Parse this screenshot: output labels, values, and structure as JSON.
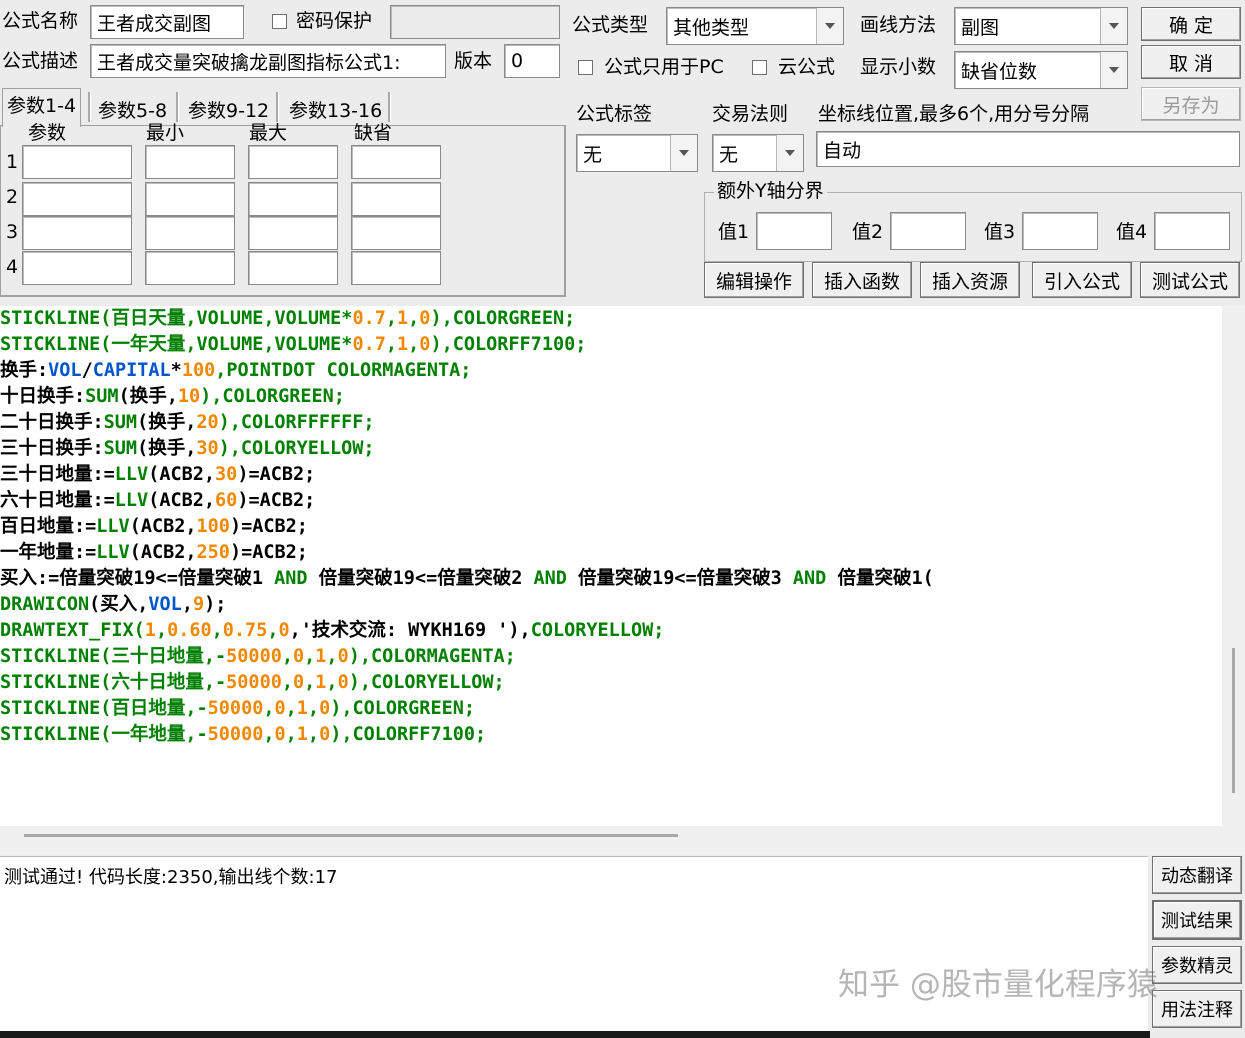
{
  "header": {
    "name_label": "公式名称",
    "name_value": "王者成交副图",
    "password_label": "密码保护",
    "desc_label": "公式描述",
    "desc_value": "王者成交量突破擒龙副图指标公式1:",
    "version_label": "版本",
    "version_value": "0",
    "type_label": "公式类型",
    "type_value": "其他类型",
    "draw_label": "画线方法",
    "draw_value": "副图",
    "pc_only_label": "公式只用于PC",
    "cloud_label": "云公式",
    "decimals_label": "显示小数",
    "decimals_value": "缺省位数"
  },
  "buttons": {
    "ok": "确  定",
    "cancel": "取  消",
    "save_as": "另存为",
    "edit": "编辑操作",
    "insert_func": "插入函数",
    "insert_res": "插入资源",
    "import_formula": "引入公式",
    "test_formula": "测试公式",
    "dyn_translate": "动态翻译",
    "test_result": "测试结果",
    "param_wizard": "参数精灵",
    "usage_notes": "用法注释"
  },
  "tabs": [
    "参数1-4",
    "参数5-8",
    "参数9-12",
    "参数13-16"
  ],
  "params": {
    "col_param": "参数",
    "col_min": "最小",
    "col_max": "最大",
    "col_default": "缺省",
    "rows": [
      "1",
      "2",
      "3",
      "4"
    ]
  },
  "options": {
    "tag_label": "公式标签",
    "tag_value": "无",
    "rule_label": "交易法则",
    "rule_value": "无",
    "axis_label": "坐标线位置,最多6个,用分号分隔",
    "axis_value": "自动",
    "extra_y_label": "额外Y轴分界",
    "v1": "值1",
    "v2": "值2",
    "v3": "值3",
    "v4": "值4"
  },
  "code_lines": [
    [
      [
        "STICKLINE(百日天量,VOLUME,VOLUME*",
        "g"
      ],
      [
        "0.7",
        "o"
      ],
      [
        ",",
        "g"
      ],
      [
        "1",
        "o"
      ],
      [
        ",",
        "g"
      ],
      [
        "0",
        "o"
      ],
      [
        "),COLORGREEN;",
        "g"
      ]
    ],
    [
      [
        "STICKLINE(一年天量,VOLUME,VOLUME*",
        "g"
      ],
      [
        "0.7",
        "o"
      ],
      [
        ",",
        "g"
      ],
      [
        "1",
        "o"
      ],
      [
        ",",
        "g"
      ],
      [
        "0",
        "o"
      ],
      [
        "),COLORFF7100;",
        "g"
      ]
    ],
    [
      [
        "换手:",
        "k"
      ],
      [
        "VOL",
        "b"
      ],
      [
        "/",
        "k"
      ],
      [
        "CAPITAL",
        "b"
      ],
      [
        "*",
        "k"
      ],
      [
        "100",
        "o"
      ],
      [
        ",POINTDOT COLORMAGENTA;",
        "g"
      ]
    ],
    [
      [
        "十日换手:",
        "k"
      ],
      [
        "SUM",
        "g"
      ],
      [
        "(换手,",
        "k"
      ],
      [
        "10",
        "o"
      ],
      [
        "),COLORGREEN;",
        "g"
      ]
    ],
    [
      [
        "二十日换手:",
        "k"
      ],
      [
        "SUM",
        "g"
      ],
      [
        "(换手,",
        "k"
      ],
      [
        "20",
        "o"
      ],
      [
        "),COLORFFFFFF;",
        "g"
      ]
    ],
    [
      [
        "三十日换手:",
        "k"
      ],
      [
        "SUM",
        "g"
      ],
      [
        "(换手,",
        "k"
      ],
      [
        "30",
        "o"
      ],
      [
        "),COLORYELLOW;",
        "g"
      ]
    ],
    [
      [
        "三十日地量:=",
        "k"
      ],
      [
        "LLV",
        "g"
      ],
      [
        "(ACB2,",
        "k"
      ],
      [
        "30",
        "o"
      ],
      [
        ")=ACB2;",
        "k"
      ]
    ],
    [
      [
        "六十日地量:=",
        "k"
      ],
      [
        "LLV",
        "g"
      ],
      [
        "(ACB2,",
        "k"
      ],
      [
        "60",
        "o"
      ],
      [
        ")=ACB2;",
        "k"
      ]
    ],
    [
      [
        "百日地量:=",
        "k"
      ],
      [
        "LLV",
        "g"
      ],
      [
        "(ACB2,",
        "k"
      ],
      [
        "100",
        "o"
      ],
      [
        ")=ACB2;",
        "k"
      ]
    ],
    [
      [
        "一年地量:=",
        "k"
      ],
      [
        "LLV",
        "g"
      ],
      [
        "(ACB2,",
        "k"
      ],
      [
        "250",
        "o"
      ],
      [
        ")=ACB2;",
        "k"
      ]
    ],
    [
      [
        "买入:=倍量突破19<=倍量突破1 ",
        "k"
      ],
      [
        "AND",
        "g"
      ],
      [
        " 倍量突破19<=倍量突破2 ",
        "k"
      ],
      [
        "AND",
        "g"
      ],
      [
        " 倍量突破19<=倍量突破3 ",
        "k"
      ],
      [
        "AND",
        "g"
      ],
      [
        " 倍量突破1(",
        "k"
      ]
    ],
    [
      [
        "DRAWICON",
        "g"
      ],
      [
        "(买入,",
        "k"
      ],
      [
        "VOL",
        "b"
      ],
      [
        ",",
        "k"
      ],
      [
        "9",
        "o"
      ],
      [
        ");",
        "k"
      ]
    ],
    [
      [
        "DRAWTEXT_FIX(",
        "g"
      ],
      [
        "1",
        "o"
      ],
      [
        ",",
        "g"
      ],
      [
        "0.60",
        "o"
      ],
      [
        ",",
        "g"
      ],
      [
        "0.75",
        "o"
      ],
      [
        ",",
        "g"
      ],
      [
        "0",
        "o"
      ],
      [
        ",'技术交流: WYKH169 '),",
        "k"
      ],
      [
        "COLORYELLOW;",
        "g"
      ]
    ],
    [
      [
        "STICKLINE(三十日地量,-",
        "g"
      ],
      [
        "50000",
        "o"
      ],
      [
        ",",
        "g"
      ],
      [
        "0",
        "o"
      ],
      [
        ",",
        "g"
      ],
      [
        "1",
        "o"
      ],
      [
        ",",
        "g"
      ],
      [
        "0",
        "o"
      ],
      [
        "),COLORMAGENTA;",
        "g"
      ]
    ],
    [
      [
        "STICKLINE(六十日地量,-",
        "g"
      ],
      [
        "50000",
        "o"
      ],
      [
        ",",
        "g"
      ],
      [
        "0",
        "o"
      ],
      [
        ",",
        "g"
      ],
      [
        "1",
        "o"
      ],
      [
        ",",
        "g"
      ],
      [
        "0",
        "o"
      ],
      [
        "),COLORYELLOW;",
        "g"
      ]
    ],
    [
      [
        "STICKLINE(百日地量,-",
        "g"
      ],
      [
        "50000",
        "o"
      ],
      [
        ",",
        "g"
      ],
      [
        "0",
        "o"
      ],
      [
        ",",
        "g"
      ],
      [
        "1",
        "o"
      ],
      [
        ",",
        "g"
      ],
      [
        "0",
        "o"
      ],
      [
        "),COLORGREEN;",
        "g"
      ]
    ],
    [
      [
        "STICKLINE(一年地量,-",
        "g"
      ],
      [
        "50000",
        "o"
      ],
      [
        ",",
        "g"
      ],
      [
        "0",
        "o"
      ],
      [
        ",",
        "g"
      ],
      [
        "1",
        "o"
      ],
      [
        ",",
        "g"
      ],
      [
        "0",
        "o"
      ],
      [
        "),COLORFF7100;",
        "g"
      ]
    ]
  ],
  "status": {
    "message": "测试通过! 代码长度:2350,输出线个数:17"
  },
  "watermark": "知乎 @股市量化程序猿",
  "colors": {
    "keyword_green": "#008000",
    "keyword_blue": "#0055cc",
    "number_orange": "#f08800"
  }
}
